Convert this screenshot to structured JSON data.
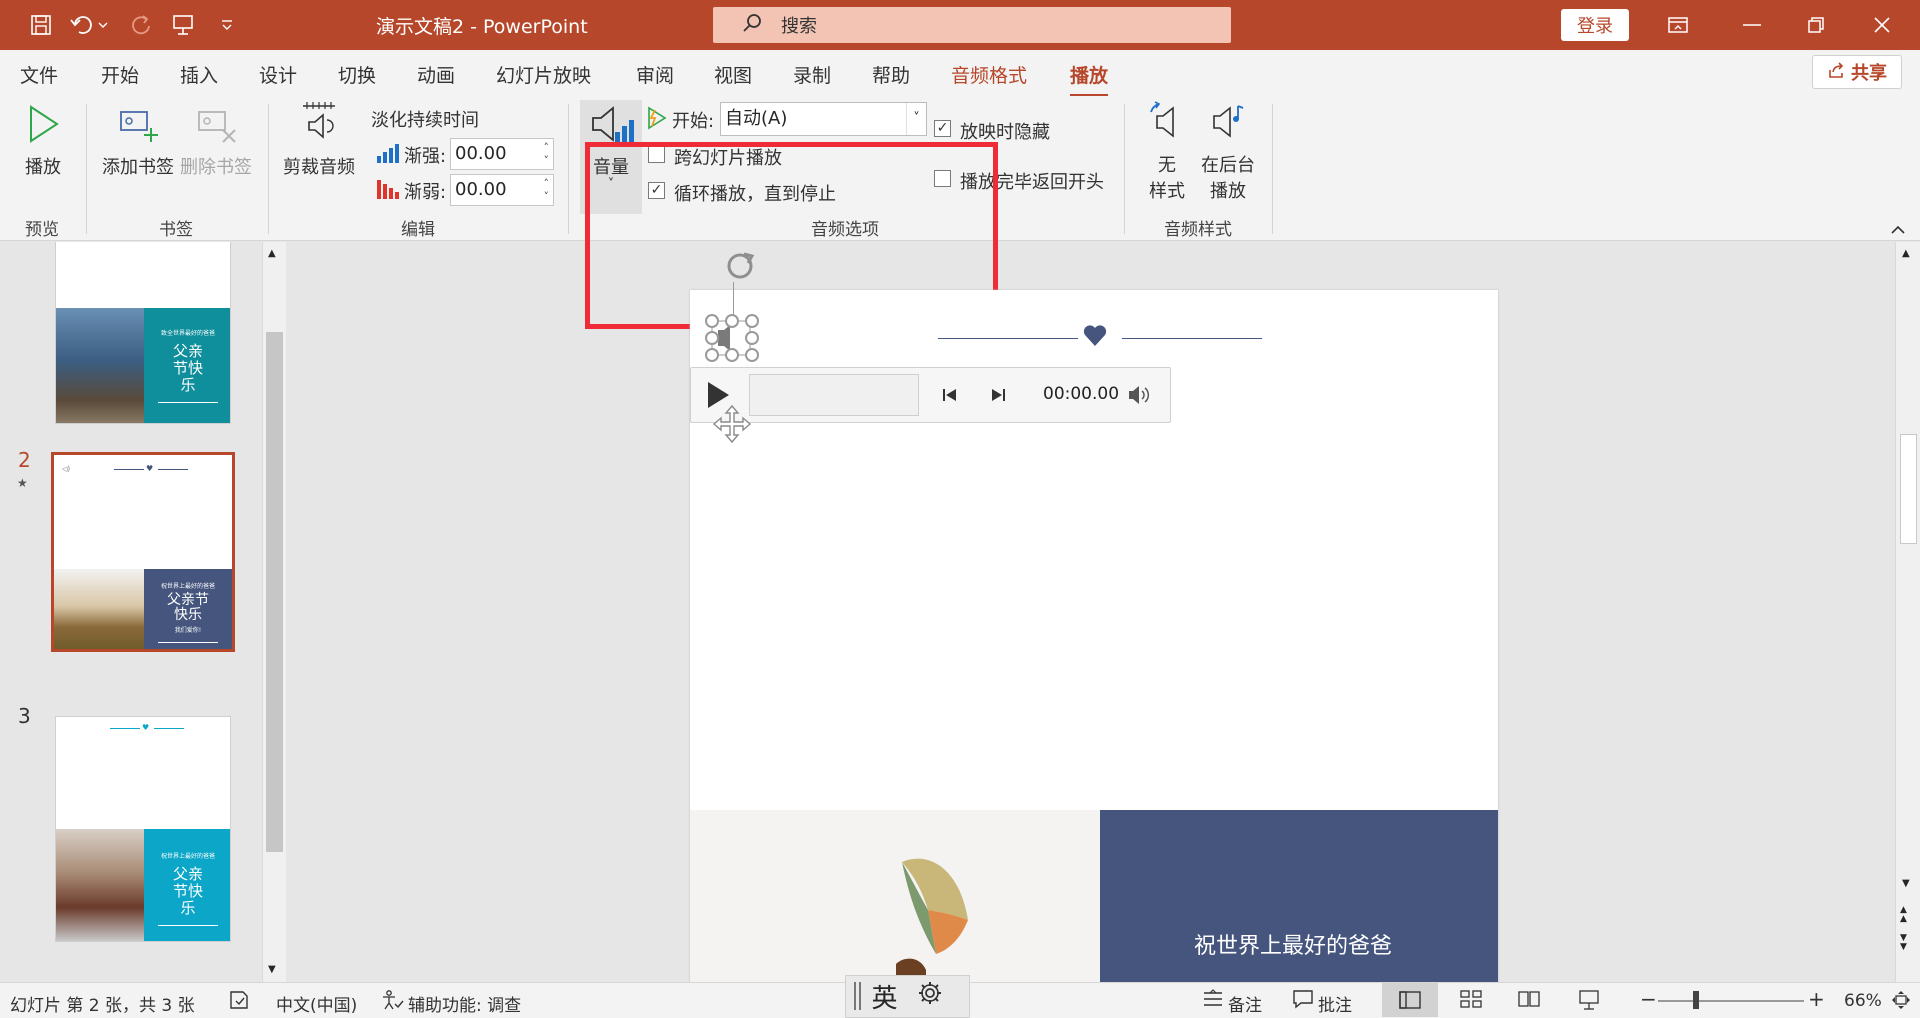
{
  "app": {
    "title": "演示文稿2  -  PowerPoint"
  },
  "search": {
    "placeholder": "搜索"
  },
  "account": {
    "login_label": "登录",
    "share_label": "共享"
  },
  "tabs": [
    {
      "label": "文件"
    },
    {
      "label": "开始"
    },
    {
      "label": "插入"
    },
    {
      "label": "设计"
    },
    {
      "label": "切换"
    },
    {
      "label": "动画"
    },
    {
      "label": "幻灯片放映"
    },
    {
      "label": "审阅"
    },
    {
      "label": "视图"
    },
    {
      "label": "录制"
    },
    {
      "label": "帮助"
    },
    {
      "label": "音频格式"
    },
    {
      "label": "播放"
    }
  ],
  "ribbon": {
    "preview": {
      "play_label": "播放",
      "group_label": "预览"
    },
    "bookmarks": {
      "add_label": "添加书签",
      "delete_label": "删除书签",
      "group_label": "书签"
    },
    "editing": {
      "trim_label": "剪裁音频",
      "fade_title": "淡化持续时间",
      "fade_in_label": "渐强:",
      "fade_in_value": "00.00",
      "fade_out_label": "渐弱:",
      "fade_out_value": "00.00",
      "group_label": "编辑"
    },
    "audio_options": {
      "volume_label": "音量",
      "start_label": "开始:",
      "start_value": "自动(A)",
      "hide_label": "放映时隐藏",
      "hide_checked": true,
      "across_label": "跨幻灯片播放",
      "across_checked": false,
      "loop_label": "循环播放，直到停止",
      "loop_checked": true,
      "rewind_label": "播放完毕返回开头",
      "rewind_checked": false,
      "group_label": "音频选项"
    },
    "audio_styles": {
      "none_label_1": "无",
      "none_label_2": "样式",
      "bg_label_1": "在后台",
      "bg_label_2": "播放",
      "group_label": "音频样式"
    }
  },
  "thumbnails": [
    {
      "number": "",
      "title": "父亲节快乐",
      "small": "致全世界最好的爸爸",
      "color": "#0f8e9c"
    },
    {
      "number": "2",
      "title": "父亲节快乐",
      "small": "祝世界上最好的爸爸",
      "sub": "我们爱你!",
      "color": "#45557e"
    },
    {
      "number": "3",
      "title": "父亲节快乐",
      "small": "祝世界上最好的爸爸",
      "color": "#0ba6c8"
    }
  ],
  "slide": {
    "caption": "祝世界上最好的爸爸",
    "audio_time": "00:00.00"
  },
  "status": {
    "slide_info": "幻灯片 第 2 张，共 3 张",
    "language": "中文(中国)",
    "accessibility": "辅助功能: 调查",
    "notes_label": "备注",
    "comments_label": "批注",
    "zoom": "66%",
    "ime_label": "英"
  },
  "colors": {
    "accent": "#b7472a",
    "highlight": "#f02b38",
    "slide_panel": "#45557e"
  }
}
